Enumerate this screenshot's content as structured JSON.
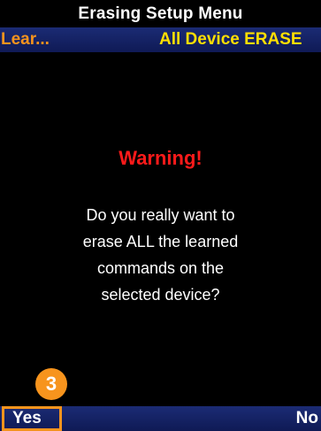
{
  "title_bar": {
    "title": "Erasing Setup Menu"
  },
  "sub_header": {
    "left_label": "Lear...",
    "right_label": "All Device ERASE"
  },
  "dialog": {
    "heading": "Warning!",
    "message": "Do you really want to\nerase ALL the learned\ncommands on the\nselected device?"
  },
  "annotation": {
    "step_number": "3"
  },
  "softkeys": {
    "left_label": "Yes",
    "right_label": "No"
  },
  "colors": {
    "screen_background": "#000000",
    "bar_background": "#14226a",
    "accent_orange": "#f7941d",
    "accent_yellow": "#ffdf00",
    "warning_red": "#ff1a1a",
    "text_white": "#ffffff"
  }
}
